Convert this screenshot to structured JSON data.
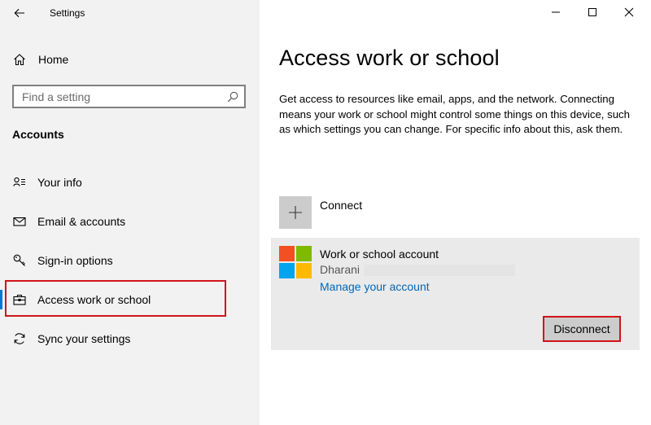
{
  "window": {
    "title": "Settings",
    "back_icon": "back-arrow-icon",
    "minimize_icon": "minimize-icon",
    "maximize_icon": "maximize-icon",
    "close_icon": "close-icon"
  },
  "sidebar": {
    "home_label": "Home",
    "search_placeholder": "Find a setting",
    "section_title": "Accounts",
    "items": [
      {
        "label": "Your info",
        "icon": "person-card-icon",
        "active": false
      },
      {
        "label": "Email & accounts",
        "icon": "mail-icon",
        "active": false
      },
      {
        "label": "Sign-in options",
        "icon": "key-icon",
        "active": false
      },
      {
        "label": "Access work or school",
        "icon": "briefcase-icon",
        "active": true
      },
      {
        "label": "Sync your settings",
        "icon": "sync-icon",
        "active": false
      }
    ]
  },
  "main": {
    "title": "Access work or school",
    "description": "Get access to resources like email, apps, and the network. Connecting means your work or school might control some things on this device, such as which settings you can change. For specific info about this, ask them.",
    "connect_label": "Connect",
    "account": {
      "type_label": "Work or school account",
      "user_name": "Dharani",
      "manage_link": "Manage your account",
      "disconnect_label": "Disconnect"
    }
  },
  "colors": {
    "accent": "#0078d7",
    "link": "#0067b8",
    "highlight": "#d0141b",
    "ms_red": "#f25022",
    "ms_green": "#7fba00",
    "ms_blue": "#00a4ef",
    "ms_yellow": "#ffb900"
  }
}
